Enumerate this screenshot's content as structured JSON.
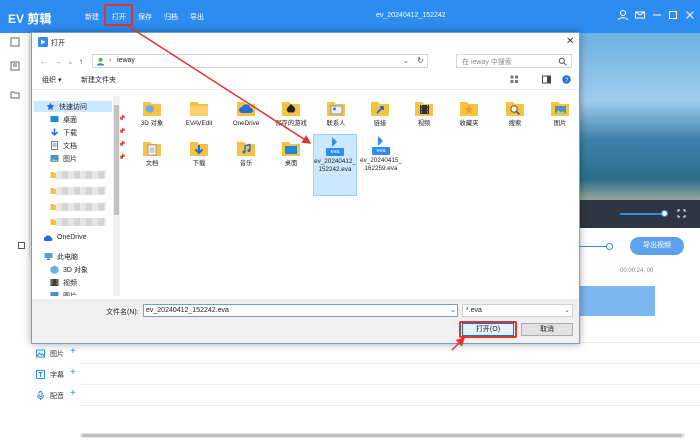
{
  "app": {
    "logo": "EV 剪辑",
    "menu": [
      "新建",
      "打开",
      "保存",
      "归档",
      "导出"
    ],
    "title": "ev_20240412_152242",
    "export_label": "导出视频",
    "timecode": "00:00:24, 00",
    "tracks": [
      {
        "label": "图片",
        "icon": "image-icon"
      },
      {
        "label": "字幕",
        "icon": "subtitle-icon"
      },
      {
        "label": "配音",
        "icon": "microphone-icon"
      }
    ],
    "accent": "#2d8cf0",
    "highlight_color": "#e0342d"
  },
  "dialog": {
    "title": "打开",
    "address": "ieway",
    "search_placeholder": "在 ieway 中搜索",
    "toolbar": {
      "organize": "组织 ▾",
      "new_folder": "新建文件夹"
    },
    "nav": {
      "quick_access": "快速访问",
      "quick_items": [
        "桌面",
        "下载",
        "文档",
        "图片"
      ],
      "onedrive": "OneDrive",
      "this_pc": "此电脑",
      "pc_items": [
        "3D 对象",
        "视频",
        "图片"
      ]
    },
    "files_row1": [
      "3D 对象",
      "EVAVEdit",
      "OneDrive",
      "保存的游戏",
      "联系人",
      "链接",
      "视频",
      "收藏夹",
      "搜索",
      "图片"
    ],
    "files_row2": [
      "文档",
      "下载",
      "音乐",
      "桌面"
    ],
    "eva_files": [
      {
        "name": "ev_20240412_152242.eva",
        "icon_label": "eva",
        "selected": true
      },
      {
        "name": "ev_20240415_162259.eva",
        "icon_label": "eva",
        "selected": false
      }
    ],
    "filename_label": "文件名(N):",
    "filename_value": "ev_20240412_152242.eva",
    "filter_value": "*.eva",
    "open_button": "打开(O)",
    "cancel_button": "取消"
  }
}
